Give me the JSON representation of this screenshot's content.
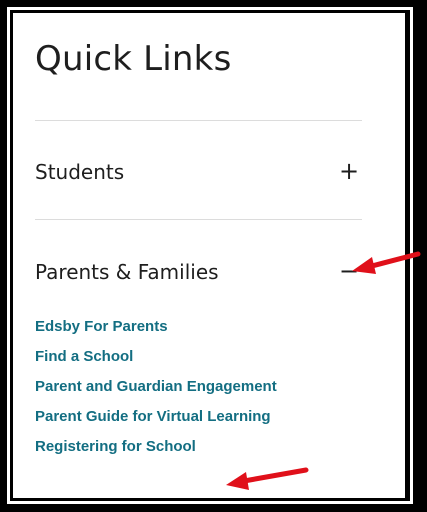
{
  "title": "Quick Links",
  "sections": [
    {
      "label": "Students",
      "toggle": "+"
    },
    {
      "label": "Parents & Families",
      "toggle": "−"
    }
  ],
  "links": [
    "Edsby For Parents",
    "Find a School",
    "Parent and Guardian Engagement",
    "Parent Guide for Virtual Learning",
    "Registering for School"
  ],
  "colors": {
    "link": "#136e82",
    "text": "#1e1e1e",
    "arrow": "#e0101a",
    "divider": "#dcdcdc",
    "frame": "#000000"
  }
}
